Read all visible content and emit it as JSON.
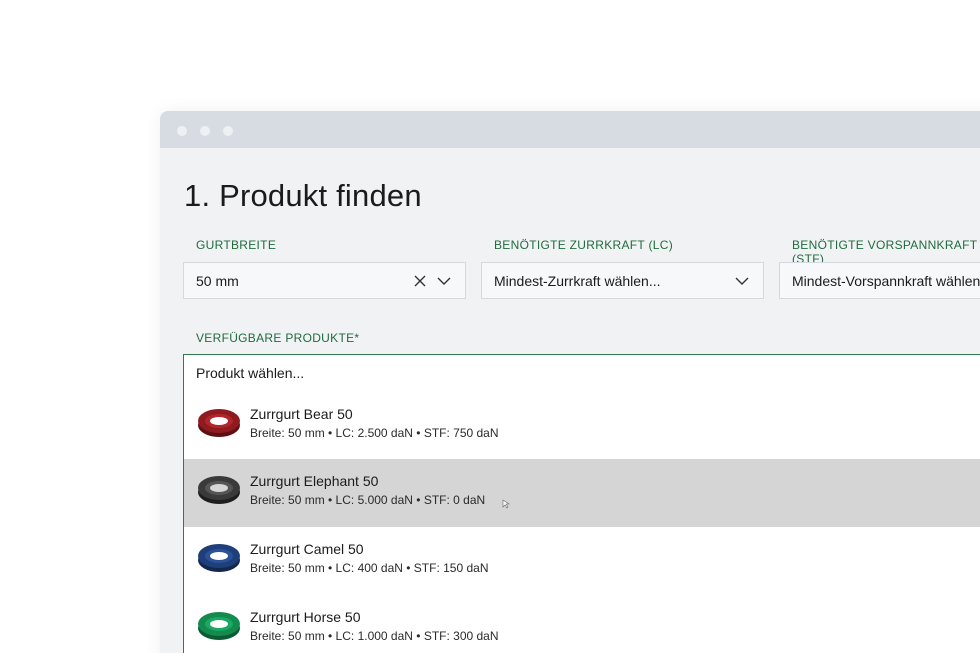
{
  "page": {
    "title": "1. Produkt finden"
  },
  "filters": [
    {
      "label": "GURTBREITE",
      "value": "50 mm",
      "clearable": true
    },
    {
      "label": "BENÖTIGTE ZURRKRAFT (LC)",
      "value": "Mindest-Zurrkraft wählen...",
      "clearable": false
    },
    {
      "label": "BENÖTIGTE VORSPANNKRAFT (STF)",
      "value": "Mindest-Vorspannkraft wählen...",
      "clearable": false
    }
  ],
  "products": {
    "label": "VERFÜGBARE PRODUKTE*",
    "placeholder": "Produkt wählen...",
    "items": [
      {
        "name": "Zurrgurt Bear 50",
        "specs": "Breite: 50 mm • LC: 2.500 daN • STF: 750 daN",
        "color": "#8e1b1f",
        "highlighted": false
      },
      {
        "name": "Zurrgurt Elephant 50",
        "specs": "Breite: 50 mm • LC: 5.000 daN • STF: 0 daN",
        "color": "#3a3a3a",
        "highlighted": true
      },
      {
        "name": "Zurrgurt Camel 50",
        "specs": "Breite: 50 mm • LC: 400 daN • STF: 150 daN",
        "color": "#1f3f7a",
        "highlighted": false
      },
      {
        "name": "Zurrgurt Horse 50",
        "specs": "Breite: 50 mm • LC: 1.000 daN • STF: 300 daN",
        "color": "#138a4e",
        "highlighted": false
      }
    ]
  },
  "colors": {
    "accent": "#1f6b3f",
    "highlight": "#d5d5d5"
  }
}
